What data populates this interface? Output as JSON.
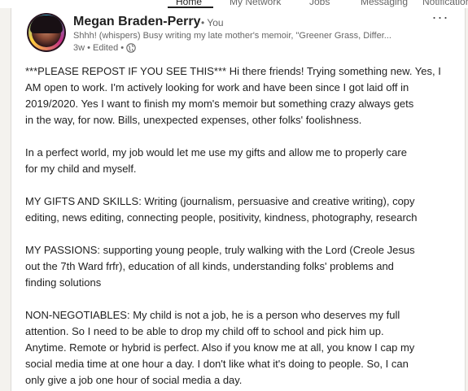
{
  "nav": {
    "items": [
      {
        "label": "Home",
        "active": true
      },
      {
        "label": "My Network",
        "active": false
      },
      {
        "label": "Jobs",
        "active": false
      },
      {
        "label": "Messaging",
        "active": false
      },
      {
        "label": "Notifications",
        "active": false
      }
    ]
  },
  "post": {
    "author_name": "Megan Braden-Perry",
    "degree": "• You",
    "headline": "Shhh! (whispers) Busy writing my late mother's memoir, \"Greener Grass, Differ...",
    "meta": "3w • Edited •",
    "visibility_icon": "globe-icon",
    "more_icon": "more-options-icon",
    "more_label": "···",
    "paragraphs": [
      [
        "***PLEASE REPOST IF YOU SEE THIS*** Hi there friends! Trying something new. Yes, I",
        "AM open to work. I'm actively looking for work and have been since I got laid off in",
        "2019/2020. Yes I want to finish my mom's memoir but something crazy always gets",
        "in the way, for now. Bills, unexpected expenses, other folks' foolishness."
      ],
      [
        "In a perfect world, my job would let me use my gifts and allow me to properly care",
        "for my child and myself."
      ],
      [
        "MY GIFTS AND SKILLS: Writing (journalism, persuasive and creative writing), copy",
        "editing, news editing, connecting people, positivity, kindness, photography, research"
      ],
      [
        "MY PASSIONS: supporting young people, truly walking with the Lord (Creole Jesus",
        "out the 7th Ward frfr), education of all kinds, understanding folks' problems and",
        "finding solutions"
      ],
      [
        "NON-NEGOTIABLES: My child is not a job, he is a person who deserves my full",
        "attention. So I need to be able to drop my child off to school and pick him up.",
        "Anytime. Remote or hybrid is perfect. Also if you know me at all, you know I cap my",
        "social media time at one hour a day. I don't like what it's doing to people. So, I can",
        "only give a job one hour of social media a day."
      ]
    ]
  }
}
